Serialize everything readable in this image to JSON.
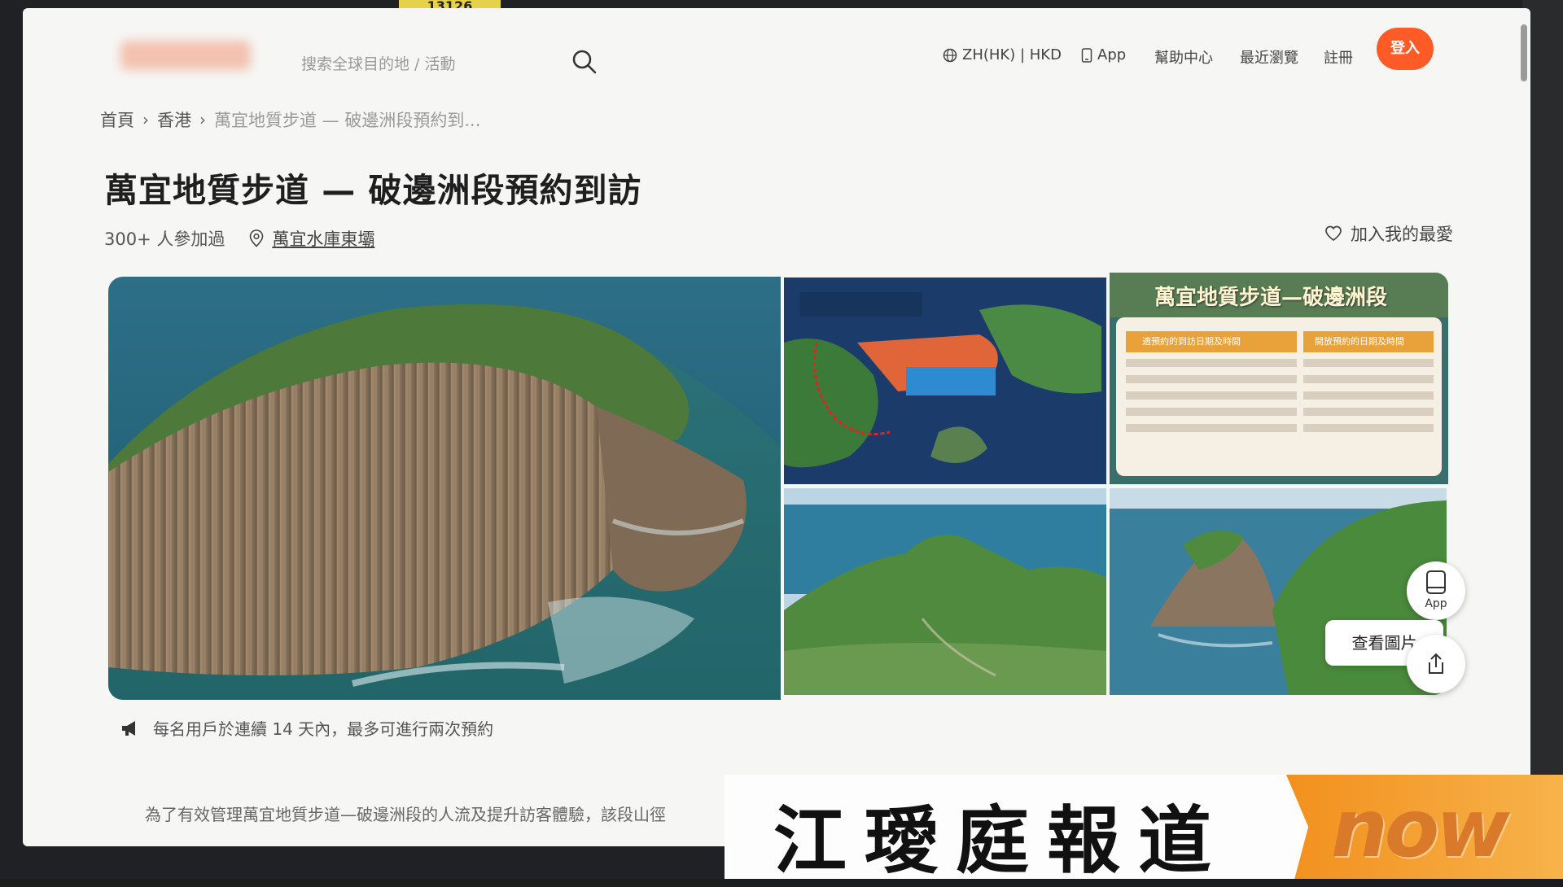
{
  "monitor_tag": "13126",
  "header": {
    "search_placeholder": "搜索全球目的地 / 活動",
    "lang_currency": "ZH(HK) | HKD",
    "app_label": "App",
    "help_label": "幫助中心",
    "recent_label": "最近瀏覽",
    "register_label": "註冊",
    "login_label": "登入"
  },
  "breadcrumb": {
    "items": [
      "首頁",
      "香港"
    ],
    "current": "萬宜地質步道 — 破邊洲段預約到..."
  },
  "activity": {
    "title": "萬宜地質步道 — 破邊洲段預約到訪",
    "participants": "300+ 人參加過",
    "location": "萬宜水庫東壩",
    "wishlist_label": "加入我的最愛"
  },
  "gallery": {
    "schedule_title": "萬宜地質步道—破邊洲段",
    "schedule_col1": "適預約的到訪日期及時間",
    "schedule_col2": "開放預約的日期及時間",
    "view_photos_label": "查看圖片",
    "float_app_label": "App"
  },
  "notice": {
    "text": "每名用戶於連續 14 天內，最多可進行兩次預約"
  },
  "intro": {
    "text": "為了有效管理萬宜地質步道—破邊洲段的人流及提升訪客體驗，該段山徑"
  },
  "caption": {
    "reporter": "江璦庭報道",
    "brand": "now"
  },
  "colors": {
    "accent": "#ff5b26",
    "caption_orange": "#f2901e"
  }
}
